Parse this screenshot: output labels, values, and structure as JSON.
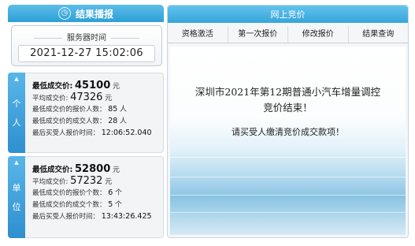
{
  "publish": {
    "title": "结果播报",
    "icon": "clock-icon",
    "server_label": "服务器时间",
    "server_time": "2021-12-27 15:02:06"
  },
  "personal": {
    "tab_label": [
      "个",
      "人"
    ],
    "min_price_label": "最低成交价:",
    "min_price": "45100",
    "min_price_unit": "元",
    "avg_price_label": "平均成交价:",
    "avg_price": "47326",
    "avg_price_unit": "元",
    "min_bidders_label": "最低成交价的报价人数：",
    "min_bidders": "85",
    "min_bidders_unit": "人",
    "min_deals_label": "最低成交价的成交人数：",
    "min_deals": "28",
    "min_deals_unit": "人",
    "last_time_label": "最后买受人报价时间：",
    "last_time": "12:06:52.040"
  },
  "unit": {
    "tab_label": [
      "单",
      "位"
    ],
    "min_price_label": "最低成交价:",
    "min_price": "52800",
    "min_price_unit": "元",
    "avg_price_label": "平均成交价:",
    "avg_price": "57232",
    "avg_price_unit": "元",
    "min_bidders_label": "最低成交价的报价个数：",
    "min_bidders": "6",
    "min_bidders_unit": "个",
    "min_deals_label": "最低成交价的成交个数：",
    "min_deals": "5",
    "min_deals_unit": "个",
    "last_time_label": "最后买受人报价时间：",
    "last_time": "13:43:26.425"
  },
  "bidding": {
    "title": "网上竞价",
    "tabs": [
      "资格激活",
      "第一次报价",
      "修改报价",
      "结果查询"
    ],
    "message_line1": "深圳市2021年第12期普通小汽车增量调控",
    "message_line2": "竞价结束！",
    "message_sub": "请买受人缴清竞价成交款项！"
  },
  "colors": {
    "header_blue": "#2d9fd6",
    "tab_blue": "#2f8fd0",
    "sea_blue": "#8bc4e3"
  }
}
